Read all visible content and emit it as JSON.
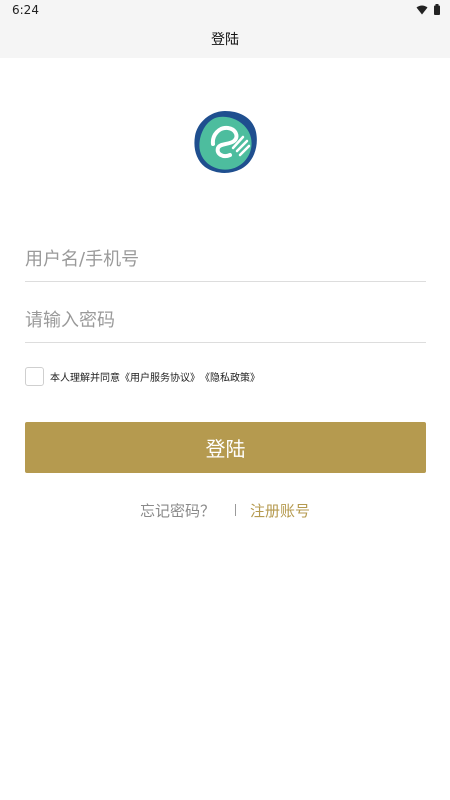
{
  "status_bar": {
    "time": "6:24",
    "icons": [
      "wifi-icon",
      "battery-icon"
    ]
  },
  "app_bar": {
    "title": "登陆"
  },
  "logo": {
    "icon": "app-logo",
    "colors": [
      "#1f4f8f",
      "#4dbd9e"
    ]
  },
  "form": {
    "username_placeholder": "用户名/手机号",
    "password_placeholder": "请输入密码",
    "agree_prefix": "本人理解并同意",
    "user_agreement": "《用户服务协议》",
    "privacy_policy": "《隐私政策》",
    "agree_checked": false
  },
  "login_button": {
    "label": "登陆",
    "color": "#b59a4f"
  },
  "links": {
    "forgot_password": "忘记密码？",
    "register": "注册账号"
  }
}
